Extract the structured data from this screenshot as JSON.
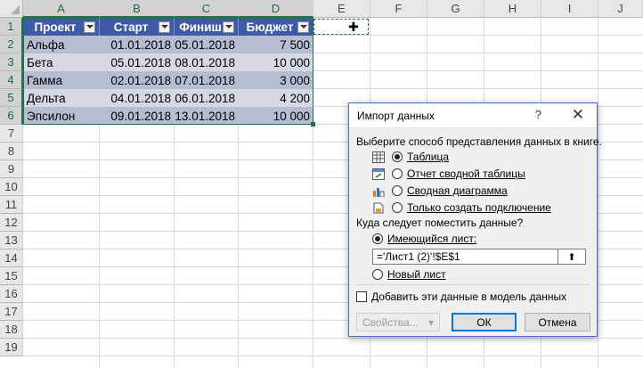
{
  "columns": [
    "A",
    "B",
    "C",
    "D",
    "E",
    "F",
    "G",
    "H",
    "I",
    "J"
  ],
  "rows": [
    "1",
    "2",
    "3",
    "4",
    "5",
    "6",
    "7",
    "8",
    "9",
    "10",
    "11",
    "12",
    "13",
    "14",
    "15",
    "16",
    "17",
    "18",
    "19"
  ],
  "table": {
    "headers": [
      "Проект",
      "Старт",
      "Финиш",
      "Бюджет"
    ],
    "rows": [
      [
        "Альфа",
        "01.01.2018",
        "05.01.2018",
        "7 500"
      ],
      [
        "Бета",
        "05.01.2018",
        "08.01.2018",
        "10 000"
      ],
      [
        "Гамма",
        "02.01.2018",
        "07.01.2018",
        "3 000"
      ],
      [
        "Дельта",
        "04.01.2018",
        "06.01.2018",
        "4 200"
      ],
      [
        "Эпсилон",
        "09.01.2018",
        "13.01.2018",
        "10 000"
      ]
    ]
  },
  "dialog": {
    "title": "Импорт данных",
    "help": "?",
    "close": "✕",
    "view_prompt": "Выберите способ представления данных в книге.",
    "view_options": [
      {
        "label": "Таблица",
        "icon": "table-icon",
        "selected": true
      },
      {
        "label": "Отчет сводной таблицы",
        "icon": "pivot-table-icon",
        "selected": false
      },
      {
        "label": "Сводная диаграмма",
        "icon": "pivot-chart-icon",
        "selected": false
      },
      {
        "label": "Только создать подключение",
        "icon": "connection-icon",
        "selected": false
      }
    ],
    "location_prompt": "Куда следует поместить данные?",
    "existing_sheet": "Имеющийся лист:",
    "reference": "='Лист1 (2)'!$E$1",
    "new_sheet": "Новый лист",
    "add_to_model": "Добавить эти данные в модель данных",
    "properties": "Свойства...",
    "ok": "ОК",
    "cancel": "Отмена"
  }
}
